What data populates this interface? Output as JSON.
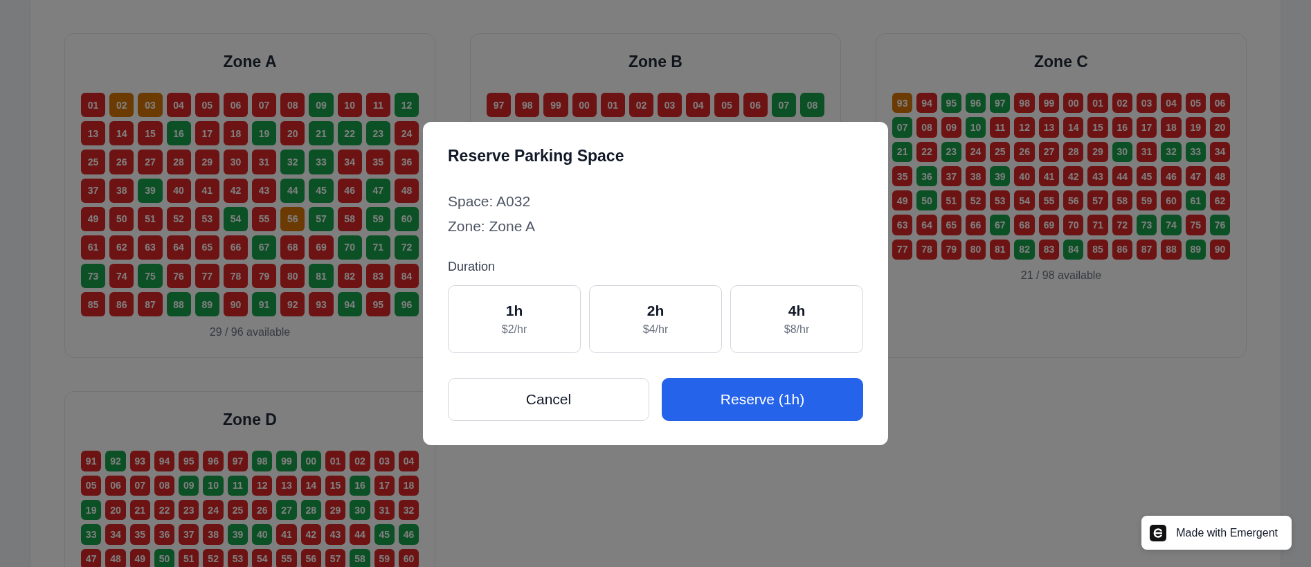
{
  "zones": [
    {
      "title": "Zone A",
      "availability": "29 / 96 available",
      "rows": [
        [
          {
            "label": "01",
            "kind": "occupied"
          },
          {
            "label": "02",
            "kind": "reserved"
          },
          {
            "label": "03",
            "kind": "reserved"
          },
          {
            "label": "04",
            "kind": "occupied"
          },
          {
            "label": "05",
            "kind": "occupied"
          },
          {
            "label": "06",
            "kind": "occupied"
          },
          {
            "label": "07",
            "kind": "occupied"
          },
          {
            "label": "08",
            "kind": "occupied"
          },
          {
            "label": "09",
            "kind": "available"
          },
          {
            "label": "10",
            "kind": "occupied"
          },
          {
            "label": "11",
            "kind": "occupied"
          },
          {
            "label": "12",
            "kind": "available"
          }
        ],
        [
          {
            "label": "13",
            "kind": "occupied"
          },
          {
            "label": "14",
            "kind": "occupied"
          },
          {
            "label": "15",
            "kind": "occupied"
          },
          {
            "label": "16",
            "kind": "available"
          },
          {
            "label": "17",
            "kind": "occupied"
          },
          {
            "label": "18",
            "kind": "occupied"
          },
          {
            "label": "19",
            "kind": "available"
          },
          {
            "label": "20",
            "kind": "occupied"
          },
          {
            "label": "21",
            "kind": "available"
          },
          {
            "label": "22",
            "kind": "available"
          },
          {
            "label": "23",
            "kind": "available"
          },
          {
            "label": "24",
            "kind": "occupied"
          }
        ],
        [
          {
            "label": "25",
            "kind": "occupied"
          },
          {
            "label": "26",
            "kind": "occupied"
          },
          {
            "label": "27",
            "kind": "occupied"
          },
          {
            "label": "28",
            "kind": "occupied"
          },
          {
            "label": "29",
            "kind": "occupied"
          },
          {
            "label": "30",
            "kind": "occupied"
          },
          {
            "label": "31",
            "kind": "occupied"
          },
          {
            "label": "32",
            "kind": "available"
          },
          {
            "label": "33",
            "kind": "available"
          },
          {
            "label": "34",
            "kind": "occupied"
          },
          {
            "label": "35",
            "kind": "occupied"
          },
          {
            "label": "36",
            "kind": "occupied"
          }
        ],
        [
          {
            "label": "37",
            "kind": "occupied"
          },
          {
            "label": "38",
            "kind": "occupied"
          },
          {
            "label": "39",
            "kind": "available"
          },
          {
            "label": "40",
            "kind": "occupied"
          },
          {
            "label": "41",
            "kind": "occupied"
          },
          {
            "label": "42",
            "kind": "occupied"
          },
          {
            "label": "43",
            "kind": "occupied"
          },
          {
            "label": "44",
            "kind": "available"
          },
          {
            "label": "45",
            "kind": "available"
          },
          {
            "label": "46",
            "kind": "occupied"
          },
          {
            "label": "47",
            "kind": "available"
          },
          {
            "label": "48",
            "kind": "occupied"
          }
        ],
        [
          {
            "label": "49",
            "kind": "occupied"
          },
          {
            "label": "50",
            "kind": "occupied"
          },
          {
            "label": "51",
            "kind": "occupied"
          },
          {
            "label": "52",
            "kind": "occupied"
          },
          {
            "label": "53",
            "kind": "occupied"
          },
          {
            "label": "54",
            "kind": "available"
          },
          {
            "label": "55",
            "kind": "occupied"
          },
          {
            "label": "56",
            "kind": "reserved"
          },
          {
            "label": "57",
            "kind": "available"
          },
          {
            "label": "58",
            "kind": "occupied"
          },
          {
            "label": "59",
            "kind": "available"
          },
          {
            "label": "60",
            "kind": "available"
          }
        ],
        [
          {
            "label": "61",
            "kind": "occupied"
          },
          {
            "label": "62",
            "kind": "occupied"
          },
          {
            "label": "63",
            "kind": "occupied"
          },
          {
            "label": "64",
            "kind": "occupied"
          },
          {
            "label": "65",
            "kind": "occupied"
          },
          {
            "label": "66",
            "kind": "occupied"
          },
          {
            "label": "67",
            "kind": "available"
          },
          {
            "label": "68",
            "kind": "occupied"
          },
          {
            "label": "69",
            "kind": "occupied"
          },
          {
            "label": "70",
            "kind": "available"
          },
          {
            "label": "71",
            "kind": "available"
          },
          {
            "label": "72",
            "kind": "available"
          }
        ],
        [
          {
            "label": "73",
            "kind": "available"
          },
          {
            "label": "74",
            "kind": "occupied"
          },
          {
            "label": "75",
            "kind": "available"
          },
          {
            "label": "76",
            "kind": "occupied"
          },
          {
            "label": "77",
            "kind": "occupied"
          },
          {
            "label": "78",
            "kind": "occupied"
          },
          {
            "label": "79",
            "kind": "occupied"
          },
          {
            "label": "80",
            "kind": "occupied"
          },
          {
            "label": "81",
            "kind": "available"
          },
          {
            "label": "82",
            "kind": "occupied"
          },
          {
            "label": "83",
            "kind": "occupied"
          },
          {
            "label": "84",
            "kind": "occupied"
          }
        ],
        [
          {
            "label": "85",
            "kind": "occupied"
          },
          {
            "label": "86",
            "kind": "occupied"
          },
          {
            "label": "87",
            "kind": "occupied"
          },
          {
            "label": "88",
            "kind": "available"
          },
          {
            "label": "89",
            "kind": "available"
          },
          {
            "label": "90",
            "kind": "occupied"
          },
          {
            "label": "91",
            "kind": "available"
          },
          {
            "label": "92",
            "kind": "occupied"
          },
          {
            "label": "93",
            "kind": "occupied"
          },
          {
            "label": "94",
            "kind": "available"
          },
          {
            "label": "95",
            "kind": "occupied"
          },
          {
            "label": "96",
            "kind": "available"
          }
        ]
      ]
    },
    {
      "title": "Zone B",
      "rows": [
        [
          {
            "label": "97",
            "kind": "occupied"
          },
          {
            "label": "98",
            "kind": "occupied"
          },
          {
            "label": "99",
            "kind": "occupied"
          },
          {
            "label": "00",
            "kind": "occupied"
          },
          {
            "label": "01",
            "kind": "occupied"
          },
          {
            "label": "02",
            "kind": "occupied"
          },
          {
            "label": "03",
            "kind": "occupied"
          },
          {
            "label": "04",
            "kind": "occupied"
          },
          {
            "label": "05",
            "kind": "occupied"
          },
          {
            "label": "06",
            "kind": "occupied"
          },
          {
            "label": "07",
            "kind": "available"
          },
          {
            "label": "08",
            "kind": "available"
          }
        ]
      ]
    },
    {
      "title": "Zone C",
      "availability": "21 / 98 available",
      "rows": [
        [
          {
            "label": "93",
            "kind": "reserved"
          },
          {
            "label": "94",
            "kind": "occupied"
          },
          {
            "label": "95",
            "kind": "available"
          },
          {
            "label": "96",
            "kind": "available"
          },
          {
            "label": "97",
            "kind": "available"
          },
          {
            "label": "98",
            "kind": "occupied"
          },
          {
            "label": "99",
            "kind": "occupied"
          },
          {
            "label": "00",
            "kind": "occupied"
          },
          {
            "label": "01",
            "kind": "occupied"
          },
          {
            "label": "02",
            "kind": "occupied"
          },
          {
            "label": "03",
            "kind": "occupied"
          },
          {
            "label": "04",
            "kind": "occupied"
          },
          {
            "label": "05",
            "kind": "occupied"
          },
          {
            "label": "06",
            "kind": "occupied"
          }
        ],
        [
          {
            "label": "07",
            "kind": "available"
          },
          {
            "label": "08",
            "kind": "occupied"
          },
          {
            "label": "09",
            "kind": "occupied"
          },
          {
            "label": "10",
            "kind": "available"
          },
          {
            "label": "11",
            "kind": "occupied"
          },
          {
            "label": "12",
            "kind": "occupied"
          },
          {
            "label": "13",
            "kind": "occupied"
          },
          {
            "label": "14",
            "kind": "occupied"
          },
          {
            "label": "15",
            "kind": "occupied"
          },
          {
            "label": "16",
            "kind": "occupied"
          },
          {
            "label": "17",
            "kind": "occupied"
          },
          {
            "label": "18",
            "kind": "occupied"
          },
          {
            "label": "19",
            "kind": "occupied"
          },
          {
            "label": "20",
            "kind": "occupied"
          }
        ],
        [
          {
            "label": "21",
            "kind": "available"
          },
          {
            "label": "22",
            "kind": "occupied"
          },
          {
            "label": "23",
            "kind": "available"
          },
          {
            "label": "24",
            "kind": "occupied"
          },
          {
            "label": "25",
            "kind": "occupied"
          },
          {
            "label": "26",
            "kind": "occupied"
          },
          {
            "label": "27",
            "kind": "occupied"
          },
          {
            "label": "28",
            "kind": "occupied"
          },
          {
            "label": "29",
            "kind": "occupied"
          },
          {
            "label": "30",
            "kind": "available"
          },
          {
            "label": "31",
            "kind": "occupied"
          },
          {
            "label": "32",
            "kind": "available"
          },
          {
            "label": "33",
            "kind": "available"
          },
          {
            "label": "34",
            "kind": "occupied"
          }
        ],
        [
          {
            "label": "35",
            "kind": "occupied"
          },
          {
            "label": "36",
            "kind": "available"
          },
          {
            "label": "37",
            "kind": "occupied"
          },
          {
            "label": "38",
            "kind": "occupied"
          },
          {
            "label": "39",
            "kind": "available"
          },
          {
            "label": "40",
            "kind": "occupied"
          },
          {
            "label": "41",
            "kind": "occupied"
          },
          {
            "label": "42",
            "kind": "occupied"
          },
          {
            "label": "43",
            "kind": "occupied"
          },
          {
            "label": "44",
            "kind": "occupied"
          },
          {
            "label": "45",
            "kind": "occupied"
          },
          {
            "label": "46",
            "kind": "occupied"
          },
          {
            "label": "47",
            "kind": "occupied"
          },
          {
            "label": "48",
            "kind": "occupied"
          }
        ],
        [
          {
            "label": "49",
            "kind": "occupied"
          },
          {
            "label": "50",
            "kind": "available"
          },
          {
            "label": "51",
            "kind": "occupied"
          },
          {
            "label": "52",
            "kind": "occupied"
          },
          {
            "label": "53",
            "kind": "occupied"
          },
          {
            "label": "54",
            "kind": "occupied"
          },
          {
            "label": "55",
            "kind": "occupied"
          },
          {
            "label": "56",
            "kind": "occupied"
          },
          {
            "label": "57",
            "kind": "occupied"
          },
          {
            "label": "58",
            "kind": "occupied"
          },
          {
            "label": "59",
            "kind": "occupied"
          },
          {
            "label": "60",
            "kind": "occupied"
          },
          {
            "label": "61",
            "kind": "available"
          },
          {
            "label": "62",
            "kind": "occupied"
          }
        ],
        [
          {
            "label": "63",
            "kind": "occupied"
          },
          {
            "label": "64",
            "kind": "occupied"
          },
          {
            "label": "65",
            "kind": "occupied"
          },
          {
            "label": "66",
            "kind": "occupied"
          },
          {
            "label": "67",
            "kind": "available"
          },
          {
            "label": "68",
            "kind": "occupied"
          },
          {
            "label": "69",
            "kind": "occupied"
          },
          {
            "label": "70",
            "kind": "occupied"
          },
          {
            "label": "71",
            "kind": "occupied"
          },
          {
            "label": "72",
            "kind": "occupied"
          },
          {
            "label": "73",
            "kind": "available"
          },
          {
            "label": "74",
            "kind": "available"
          },
          {
            "label": "75",
            "kind": "occupied"
          },
          {
            "label": "76",
            "kind": "available"
          }
        ],
        [
          {
            "label": "77",
            "kind": "occupied"
          },
          {
            "label": "78",
            "kind": "occupied"
          },
          {
            "label": "79",
            "kind": "occupied"
          },
          {
            "label": "80",
            "kind": "occupied"
          },
          {
            "label": "81",
            "kind": "occupied"
          },
          {
            "label": "82",
            "kind": "available"
          },
          {
            "label": "83",
            "kind": "occupied"
          },
          {
            "label": "84",
            "kind": "available"
          },
          {
            "label": "85",
            "kind": "occupied"
          },
          {
            "label": "86",
            "kind": "occupied"
          },
          {
            "label": "87",
            "kind": "occupied"
          },
          {
            "label": "88",
            "kind": "occupied"
          },
          {
            "label": "89",
            "kind": "available"
          },
          {
            "label": "90",
            "kind": "occupied"
          }
        ]
      ]
    },
    {
      "title": "Zone D",
      "rows": [
        [
          {
            "label": "91",
            "kind": "occupied"
          },
          {
            "label": "92",
            "kind": "available"
          },
          {
            "label": "93",
            "kind": "occupied"
          },
          {
            "label": "94",
            "kind": "occupied"
          },
          {
            "label": "95",
            "kind": "occupied"
          },
          {
            "label": "96",
            "kind": "occupied"
          },
          {
            "label": "97",
            "kind": "occupied"
          },
          {
            "label": "98",
            "kind": "available"
          },
          {
            "label": "99",
            "kind": "available"
          },
          {
            "label": "00",
            "kind": "available"
          },
          {
            "label": "01",
            "kind": "occupied"
          },
          {
            "label": "02",
            "kind": "occupied"
          },
          {
            "label": "03",
            "kind": "occupied"
          },
          {
            "label": "04",
            "kind": "occupied"
          }
        ],
        [
          {
            "label": "05",
            "kind": "occupied"
          },
          {
            "label": "06",
            "kind": "occupied"
          },
          {
            "label": "07",
            "kind": "occupied"
          },
          {
            "label": "08",
            "kind": "occupied"
          },
          {
            "label": "09",
            "kind": "available"
          },
          {
            "label": "10",
            "kind": "available"
          },
          {
            "label": "11",
            "kind": "available"
          },
          {
            "label": "12",
            "kind": "occupied"
          },
          {
            "label": "13",
            "kind": "occupied"
          },
          {
            "label": "14",
            "kind": "occupied"
          },
          {
            "label": "15",
            "kind": "occupied"
          },
          {
            "label": "16",
            "kind": "available"
          },
          {
            "label": "17",
            "kind": "occupied"
          },
          {
            "label": "18",
            "kind": "occupied"
          }
        ],
        [
          {
            "label": "19",
            "kind": "available"
          },
          {
            "label": "20",
            "kind": "occupied"
          },
          {
            "label": "21",
            "kind": "occupied"
          },
          {
            "label": "22",
            "kind": "occupied"
          },
          {
            "label": "23",
            "kind": "occupied"
          },
          {
            "label": "24",
            "kind": "occupied"
          },
          {
            "label": "25",
            "kind": "occupied"
          },
          {
            "label": "26",
            "kind": "occupied"
          },
          {
            "label": "27",
            "kind": "available"
          },
          {
            "label": "28",
            "kind": "available"
          },
          {
            "label": "29",
            "kind": "occupied"
          },
          {
            "label": "30",
            "kind": "available"
          },
          {
            "label": "31",
            "kind": "occupied"
          },
          {
            "label": "32",
            "kind": "occupied"
          }
        ],
        [
          {
            "label": "33",
            "kind": "available"
          },
          {
            "label": "34",
            "kind": "occupied"
          },
          {
            "label": "35",
            "kind": "occupied"
          },
          {
            "label": "36",
            "kind": "occupied"
          },
          {
            "label": "37",
            "kind": "occupied"
          },
          {
            "label": "38",
            "kind": "occupied"
          },
          {
            "label": "39",
            "kind": "available"
          },
          {
            "label": "40",
            "kind": "available"
          },
          {
            "label": "41",
            "kind": "occupied"
          },
          {
            "label": "42",
            "kind": "occupied"
          },
          {
            "label": "43",
            "kind": "occupied"
          },
          {
            "label": "44",
            "kind": "occupied"
          },
          {
            "label": "45",
            "kind": "available"
          },
          {
            "label": "46",
            "kind": "available"
          }
        ],
        [
          {
            "label": "47",
            "kind": "occupied"
          },
          {
            "label": "48",
            "kind": "occupied"
          },
          {
            "label": "49",
            "kind": "occupied"
          },
          {
            "label": "50",
            "kind": "available"
          },
          {
            "label": "51",
            "kind": "occupied"
          },
          {
            "label": "52",
            "kind": "occupied"
          },
          {
            "label": "53",
            "kind": "occupied"
          },
          {
            "label": "54",
            "kind": "occupied"
          },
          {
            "label": "55",
            "kind": "occupied"
          },
          {
            "label": "56",
            "kind": "occupied"
          },
          {
            "label": "57",
            "kind": "occupied"
          },
          {
            "label": "58",
            "kind": "available"
          },
          {
            "label": "59",
            "kind": "occupied"
          },
          {
            "label": "60",
            "kind": "occupied"
          }
        ]
      ]
    }
  ],
  "modal": {
    "title": "Reserve Parking Space",
    "details": [
      "Space: A032",
      "Zone: Zone A"
    ],
    "duration_label": "Duration",
    "durations": [
      {
        "label": "1h",
        "price": "$2/hr"
      },
      {
        "label": "2h",
        "price": "$4/hr"
      },
      {
        "label": "4h",
        "price": "$8/hr"
      }
    ],
    "buttons": [
      {
        "label": "Cancel",
        "kind": "secondary"
      },
      {
        "label": "Reserve (1h)",
        "kind": "primary"
      }
    ]
  },
  "badge": {
    "label": "Made with Emergent"
  }
}
